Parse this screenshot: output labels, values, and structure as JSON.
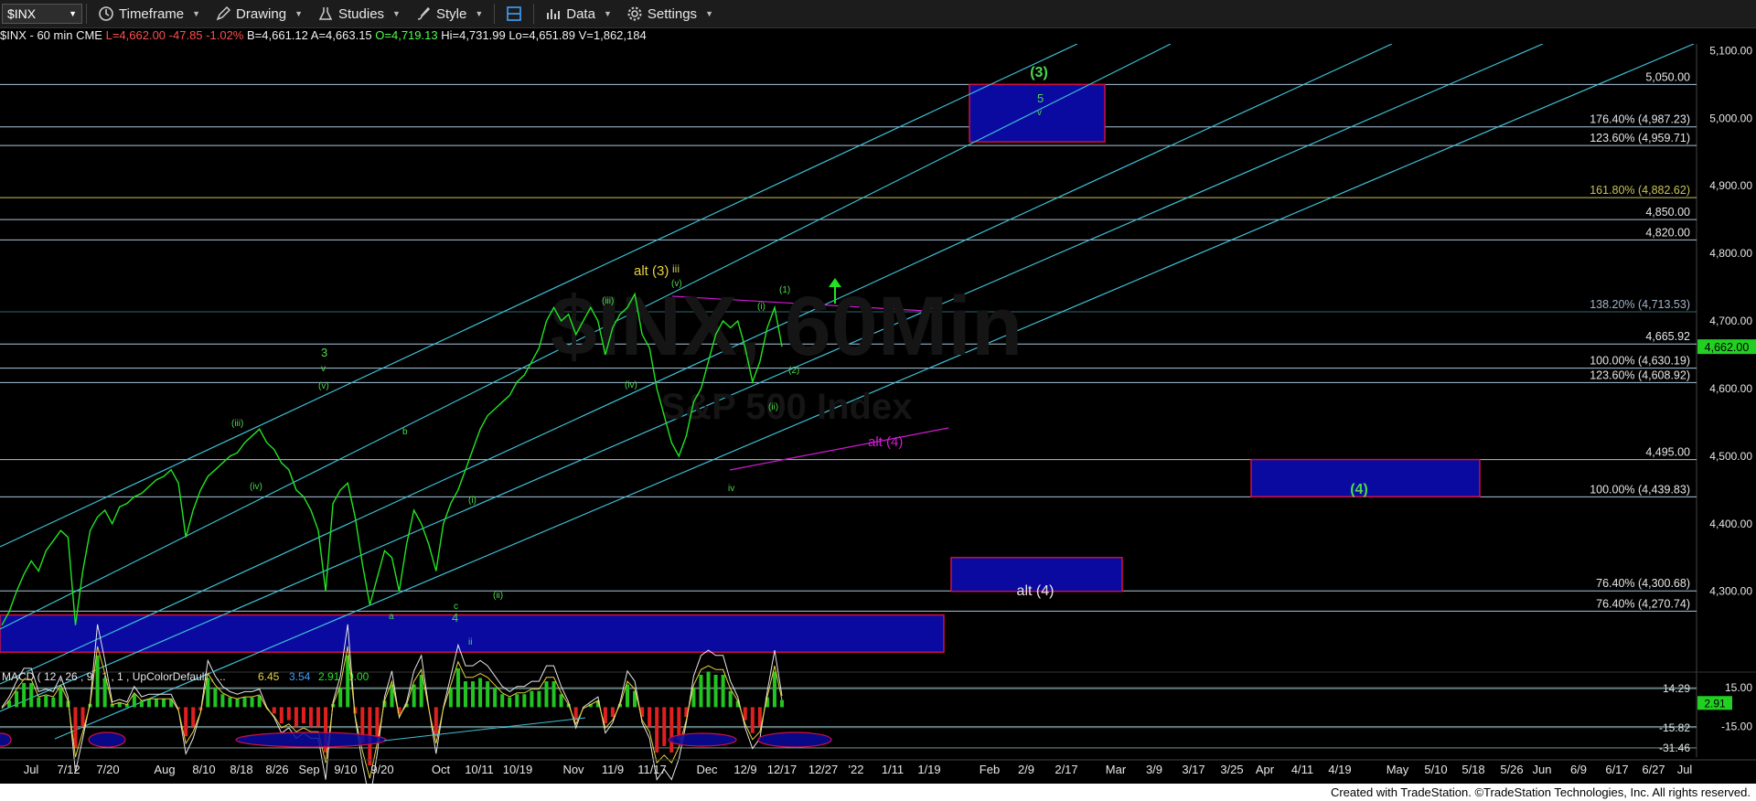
{
  "toolbar": {
    "symbol": "$INX",
    "timeframe_label": "Timeframe",
    "drawing_label": "Drawing",
    "studies_label": "Studies",
    "style_label": "Style",
    "data_label": "Data",
    "settings_label": "Settings",
    "icons": [
      "clock-icon",
      "pencil-icon",
      "flask-icon",
      "brush-icon",
      "layout-icon",
      "bar-chart-icon",
      "gear-icon"
    ]
  },
  "status_bar": {
    "prefix": "$INX - 60 min  CME",
    "last": "L=4,662.00",
    "change": "-47.85",
    "change_pct": "-1.02%",
    "bid": "B=4,661.12",
    "ask": "A=4,663.15",
    "open": "O=4,719.13",
    "high": "Hi=4,731.99",
    "low": "Lo=4,651.89",
    "volume": "V=1,862,184"
  },
  "watermark": {
    "line1": "$INX, 60Min",
    "line2": "S&P 500 Index"
  },
  "footer": {
    "text": "Created with TradeStation. ©TradeStation Technologies, Inc. All rights reserved."
  },
  "colors": {
    "price": "#22e422",
    "channel": "#3fc0d6",
    "level": "#a8c4dc",
    "fib_gold": "#c8c35a",
    "box_fill": "#0a0aa0",
    "box_border": "#cc1144",
    "magenta": "#d21ad2",
    "wave_label": "#4cd84c",
    "alt_label": "#e6d23c",
    "last_price_bg": "#22d022"
  },
  "chart_data": {
    "type": "line",
    "title": "",
    "ylim": [
      4190,
      5110
    ],
    "y_ticks": [
      4300,
      4400,
      4500,
      4600,
      4700,
      4800,
      4900,
      5000,
      5100
    ],
    "y_tick_labels": [
      "4,300.00",
      "4,400.00",
      "4,500.00",
      "4,600.00",
      "4,700.00",
      "4,800.00",
      "4,900.00",
      "5,000.00",
      "5,100.00"
    ],
    "last_price": 4662.0,
    "last_price_label": "4,662.00",
    "x_labels": [
      "Jul",
      "7/12",
      "7/20",
      "Aug",
      "8/10",
      "8/18",
      "8/26",
      "Sep",
      "9/10",
      "9/20",
      "Oct",
      "10/11",
      "10/19",
      "Nov",
      "11/9",
      "11/17",
      "Dec",
      "12/9",
      "12/17",
      "12/27",
      "'22",
      "1/11",
      "1/19",
      "Feb",
      "2/9",
      "2/17",
      "Mar",
      "3/9",
      "3/17",
      "3/25",
      "Apr",
      "4/11",
      "4/19",
      "May",
      "5/10",
      "5/18",
      "5/26",
      "Jun",
      "6/9",
      "6/17",
      "6/27",
      "Jul"
    ],
    "series": [
      {
        "values": [
          4250,
          4270,
          4300,
          4325,
          4345,
          4330,
          4360,
          4375,
          4390,
          4380,
          4250,
          4330,
          4390,
          4410,
          4420,
          4400,
          4425,
          4430,
          4440,
          4445,
          4455,
          4465,
          4470,
          4480,
          4460,
          4380,
          4420,
          4450,
          4470,
          4480,
          4490,
          4500,
          4505,
          4520,
          4530,
          4540,
          4520,
          4510,
          4490,
          4480,
          4450,
          4440,
          4420,
          4390,
          4300,
          4430,
          4450,
          4460,
          4410,
          4340,
          4280,
          4320,
          4360,
          4350,
          4300,
          4370,
          4420,
          4400,
          4370,
          4330,
          4400,
          4430,
          4450,
          4480,
          4510,
          4540,
          4560,
          4570,
          4580,
          4590,
          4610,
          4620,
          4640,
          4660,
          4700,
          4720,
          4700,
          4710,
          4680,
          4700,
          4720,
          4700,
          4650,
          4690,
          4710,
          4720,
          4740,
          4680,
          4660,
          4600,
          4560,
          4520,
          4500,
          4530,
          4580,
          4600,
          4640,
          4680,
          4700,
          4690,
          4700,
          4660,
          4610,
          4640,
          4690,
          4720,
          4662
        ]
      }
    ],
    "levels": [
      {
        "label": "5,050.00",
        "value": 5050.0
      },
      {
        "label": "176.40% (4,987.23)",
        "value": 4987.23
      },
      {
        "label": "123.60% (4,959.71)",
        "value": 4959.71
      },
      {
        "label": "161.80% (4,882.62)",
        "value": 4882.62
      },
      {
        "label": "4,850.00",
        "value": 4850.0
      },
      {
        "label": "4,820.00",
        "value": 4820.0
      },
      {
        "label": "138.20% (4,713.53)",
        "value": 4713.53
      },
      {
        "label": "4,665.92",
        "value": 4665.92
      },
      {
        "label": "100.00% (4,630.19)",
        "value": 4630.19
      },
      {
        "label": "123.60% (4,608.92)",
        "value": 4608.92
      },
      {
        "label": "4,495.00",
        "value": 4495.0
      },
      {
        "label": "100.00% (4,439.83)",
        "value": 4439.83
      },
      {
        "label": "76.40% (4,300.68)",
        "value": 4300.68
      },
      {
        "label": "76.40% (4,270.74)",
        "value": 4270.74
      }
    ],
    "target_boxes": [
      {
        "label": "(3)",
        "top": 5050,
        "bottom": 4965,
        "label_kind": "wave"
      },
      {
        "label": "(4)",
        "top": 4495,
        "bottom": 4440,
        "label_kind": "wave"
      },
      {
        "label": "alt (4)",
        "top": 4350,
        "bottom": 4300,
        "label_kind": "alt"
      },
      {
        "label": "",
        "top": 4265,
        "bottom": 4210,
        "label_kind": "none"
      }
    ],
    "wave_labels": [
      "3",
      "v",
      "(v)",
      "(iii)",
      "(iv)",
      "b",
      "a",
      "c",
      "4",
      "(i)",
      "(ii)",
      "ii",
      "alt (3)",
      "iii",
      "(v)",
      "(iii)",
      "(iv)",
      "iv",
      "(i)",
      "(1)",
      "(2)",
      "(ii)",
      "5",
      "v",
      "alt (4)"
    ],
    "macd": {
      "title": "MACD ( 12 , 26 , 9 , 1 , 1 , UpColorDefault , ...",
      "values": [
        "6.45",
        "3.54",
        "2.91",
        "0.00"
      ],
      "value_colors": [
        "#e6d23c",
        "#3fa0ff",
        "#22e422",
        "#22e422"
      ],
      "ylim": [
        -40,
        25
      ],
      "ticks": [
        14.29,
        15.0,
        -15.0,
        -15.82,
        -31.46
      ],
      "tick_labels": [
        "14.29",
        "15.00",
        "-15.00",
        "-15.82",
        "-31.46"
      ],
      "current_label": "2.91"
    }
  }
}
